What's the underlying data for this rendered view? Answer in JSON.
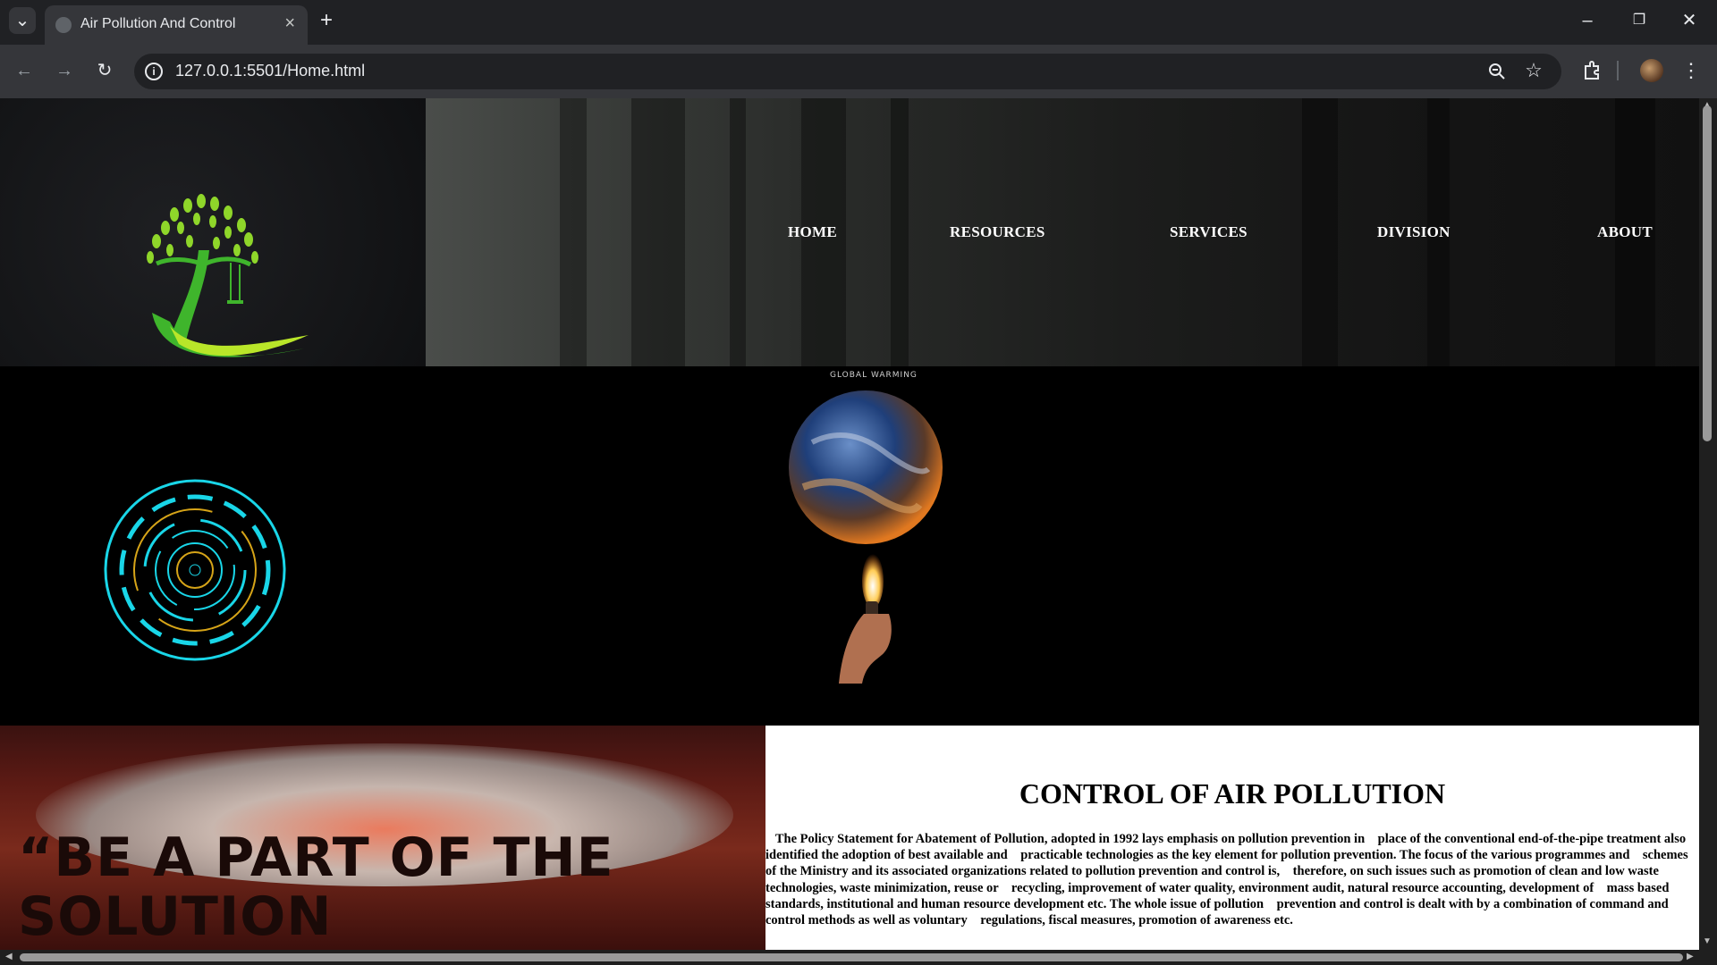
{
  "browser": {
    "tab_title": "Air Pollution And Control",
    "url": "127.0.0.1:5501/Home.html",
    "icons": [
      "tab-list-icon",
      "globe-icon",
      "close-icon",
      "new-tab-icon",
      "minimize-icon",
      "restore-icon",
      "window-close-icon",
      "back-icon",
      "forward-icon",
      "reload-icon",
      "site-info-icon",
      "zoom-icon",
      "bookmark-star-icon",
      "extensions-icon",
      "profile-avatar",
      "menu-icon"
    ]
  },
  "nav": {
    "items": [
      {
        "label": "HOME"
      },
      {
        "label": "RESOURCES"
      },
      {
        "label": "SERVICES"
      },
      {
        "label": "DIVISION"
      },
      {
        "label": "ABOUT"
      }
    ]
  },
  "hero": {
    "globe_caption": "Global Warming"
  },
  "poster": {
    "text": "“BE A PART OF THE SOLUTION"
  },
  "article": {
    "heading": "CONTROL OF AIR POLLUTION",
    "body": "   The Policy Statement for Abatement of Pollution, adopted in 1992 lays emphasis on pollution prevention in    place of the conventional end-of-the-pipe treatment also identified the adoption of best available and    practicable technologies as the key element for pollution prevention. The focus of the various programmes and    schemes of the Ministry and its associated organizations related to pollution prevention and control is,    therefore, on such issues such as promotion of clean and low waste technologies, waste minimization, reuse or    recycling, improvement of water quality, environment audit, natural resource accounting, development of    mass based standards, institutional and human resource development etc. The whole issue of pollution    prevention and control is dealt with by a combination of command and control methods as well as voluntary    regulations, fiscal measures, promotion of awareness etc."
  },
  "colors": {
    "accent_cyan": "#19d6e8",
    "accent_gold": "#d6a418",
    "logo_green": "#7dd42a"
  }
}
